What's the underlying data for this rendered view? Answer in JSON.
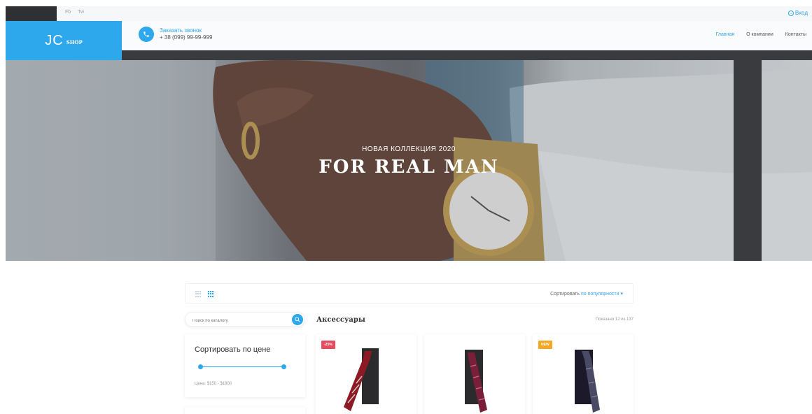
{
  "topbar": {
    "socials": [
      "Fb",
      "Tw"
    ],
    "login_label": "Вход"
  },
  "header": {
    "logo_main": "JC",
    "logo_sub": "SHOP",
    "call_label": "Заказать звонок",
    "phone": "+ 38 (099) 99-99-999",
    "nav": [
      {
        "label": "Главная",
        "active": true
      },
      {
        "label": "О компании",
        "active": false
      },
      {
        "label": "Контакты",
        "active": false
      }
    ]
  },
  "hero": {
    "subtitle": "НОВАЯ КОЛЛЕКЦИЯ 2020",
    "title": "FOR REAL MAN"
  },
  "toolbar": {
    "sort_label": "Сортировать",
    "sort_value": "по популярности"
  },
  "search": {
    "placeholder": "Поиск по каталогу"
  },
  "price_filter": {
    "title": "Сортировать по цене",
    "range_label": "Цена:  $150 - $1800"
  },
  "catalog": {
    "title": "Аксессуары",
    "shown": "Показано 12 из 137",
    "products": [
      {
        "badge": "-25%",
        "badge_color": "#e84a5f",
        "tie_color": "#8b1a24"
      },
      {
        "badge": "",
        "badge_color": "",
        "tie_color": "#7a1f3a"
      },
      {
        "badge": "NEW",
        "badge_color": "#f5a623",
        "tie_color": "#1c1a2a"
      }
    ]
  },
  "colors": {
    "accent": "#2ea8ec",
    "dark": "#2f3033"
  }
}
